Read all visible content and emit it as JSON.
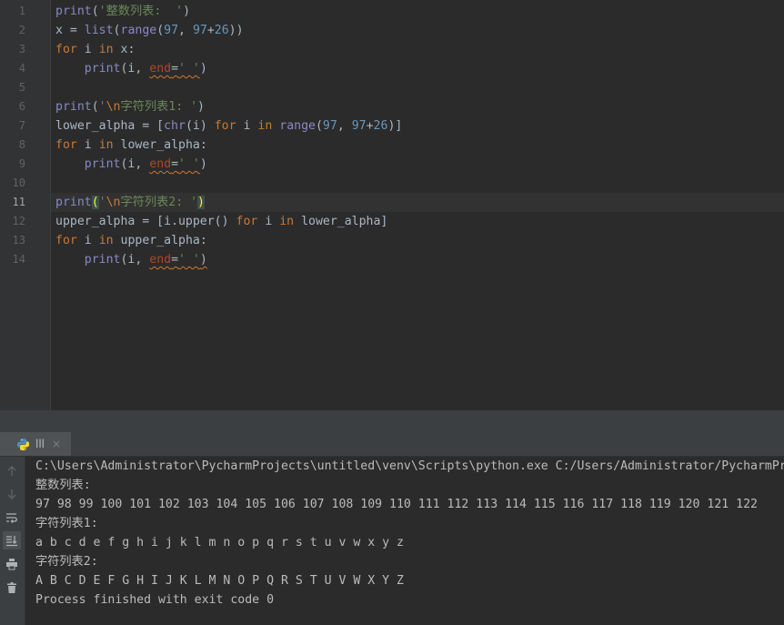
{
  "editor": {
    "line_numbers": [
      "1",
      "2",
      "3",
      "4",
      "5",
      "6",
      "7",
      "8",
      "9",
      "10",
      "11",
      "12",
      "13",
      "14"
    ],
    "current_line": 11,
    "tokens": {
      "print": "print",
      "list": "list",
      "range": "range",
      "chr": "chr",
      "for": "for",
      "in": "in",
      "end": "end",
      "n97": "97",
      "n26": "26",
      "x": "x",
      "i": "i",
      "lower_alpha": "lower_alpha",
      "upper_alpha": "upper_alpha",
      "upper_call": "i.upper()",
      "s1": "'整数列表:  '",
      "s2_open": "'",
      "s2_esc": "\\n",
      "s2_rest": "字符列表1: '",
      "s3_rest": "字符列表2: '",
      "space_str": "' '"
    }
  },
  "run_panel": {
    "tab_label": "lll",
    "close_glyph": "×",
    "output": [
      "C:\\Users\\Administrator\\PycharmProjects\\untitled\\venv\\Scripts\\python.exe C:/Users/Administrator/PycharmProjects/untitled",
      "整数列表:",
      "97 98 99 100 101 102 103 104 105 106 107 108 109 110 111 112 113 114 115 116 117 118 119 120 121 122",
      "字符列表1:",
      "a b c d e f g h i j k l m n o p q r s t u v w x y z",
      "字符列表2:",
      "A B C D E F G H I J K L M N O P Q R S T U V W X Y Z",
      "Process finished with exit code 0"
    ]
  },
  "toolbar_icons": [
    "arrow-up-icon",
    "arrow-down-icon",
    "soft-wrap-icon",
    "scroll-to-end-icon",
    "print-icon",
    "trash-icon"
  ],
  "colors": {
    "background": "#2b2b2b",
    "keyword": "#cc7832",
    "string": "#6a8759",
    "number": "#6897bb",
    "builtin": "#8888c6"
  }
}
